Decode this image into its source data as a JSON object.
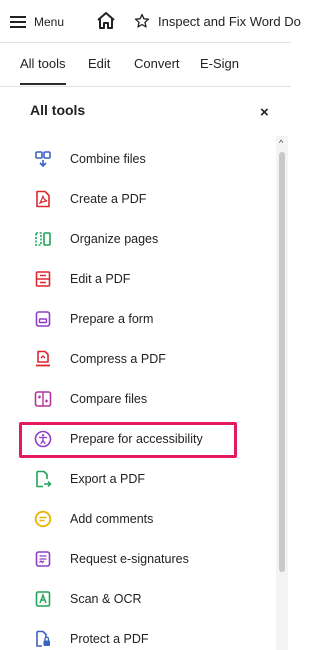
{
  "topbar": {
    "menu_label": "Menu",
    "doc_title": "Inspect and Fix Word Do"
  },
  "tabs": [
    {
      "label": "All tools",
      "active": true
    },
    {
      "label": "Edit",
      "active": false
    },
    {
      "label": "Convert",
      "active": false
    },
    {
      "label": "E-Sign",
      "active": false
    }
  ],
  "panel": {
    "title": "All tools",
    "close_symbol": "×"
  },
  "tools": [
    {
      "label": "Combine files",
      "icon": "combine-files-icon",
      "color": "#3b63c4"
    },
    {
      "label": "Create a PDF",
      "icon": "create-pdf-icon",
      "color": "#e0262e"
    },
    {
      "label": "Organize pages",
      "icon": "organize-pages-icon",
      "color": "#21a45a"
    },
    {
      "label": "Edit a PDF",
      "icon": "edit-pdf-icon",
      "color": "#e0262e"
    },
    {
      "label": "Prepare a form",
      "icon": "prepare-form-icon",
      "color": "#8d3fc8"
    },
    {
      "label": "Compress a PDF",
      "icon": "compress-pdf-icon",
      "color": "#e0262e"
    },
    {
      "label": "Compare files",
      "icon": "compare-files-icon",
      "color": "#b6339e"
    },
    {
      "label": "Prepare for accessibility",
      "icon": "accessibility-icon",
      "color": "#8d3fc8"
    },
    {
      "label": "Export a PDF",
      "icon": "export-pdf-icon",
      "color": "#21a45a"
    },
    {
      "label": "Add comments",
      "icon": "add-comments-icon",
      "color": "#e8b400"
    },
    {
      "label": "Request e-signatures",
      "icon": "request-esignatures-icon",
      "color": "#8d3fc8"
    },
    {
      "label": "Scan & OCR",
      "icon": "scan-ocr-icon",
      "color": "#21a45a"
    },
    {
      "label": "Protect a PDF",
      "icon": "protect-pdf-icon",
      "color": "#3b63c4"
    }
  ],
  "highlighted_tool": "Prepare for accessibility",
  "colors": {
    "highlight": "#e5195f"
  }
}
